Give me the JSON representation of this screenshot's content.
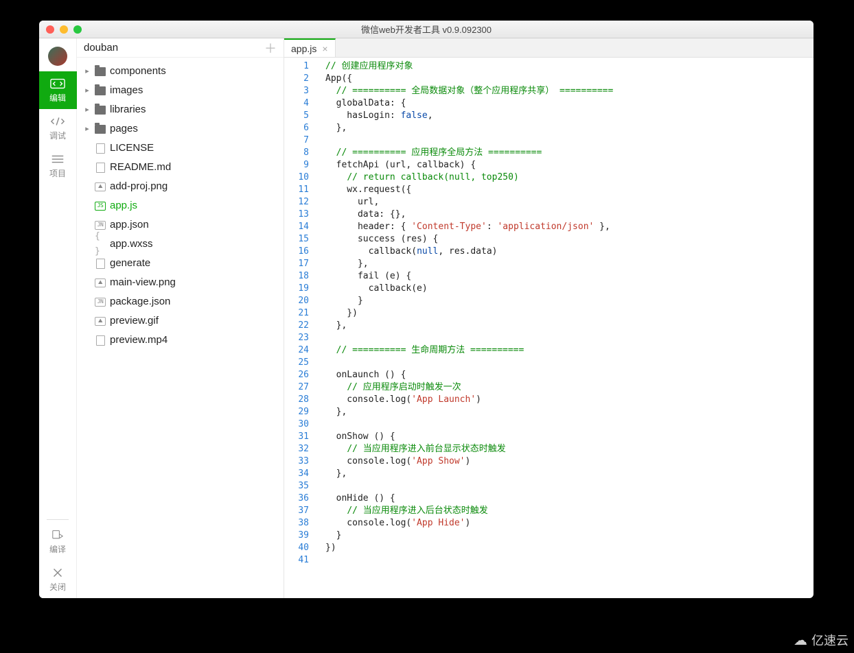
{
  "window": {
    "title": "微信web开发者工具 v0.9.092300"
  },
  "rail": {
    "items": [
      {
        "label": "编辑",
        "icon": "code"
      },
      {
        "label": "调试",
        "icon": "debug"
      },
      {
        "label": "项目",
        "icon": "menu"
      }
    ],
    "bottom": [
      {
        "label": "编译",
        "icon": "compile"
      },
      {
        "label": "关闭",
        "icon": "close"
      }
    ]
  },
  "project": {
    "name": "douban"
  },
  "tree": [
    {
      "type": "folder",
      "name": "components"
    },
    {
      "type": "folder",
      "name": "images"
    },
    {
      "type": "folder",
      "name": "libraries"
    },
    {
      "type": "folder",
      "name": "pages"
    },
    {
      "type": "file",
      "name": "LICENSE",
      "icon": "file"
    },
    {
      "type": "file",
      "name": "README.md",
      "icon": "file"
    },
    {
      "type": "file",
      "name": "add-proj.png",
      "icon": "img"
    },
    {
      "type": "file",
      "name": "app.js",
      "icon": "js",
      "active": true
    },
    {
      "type": "file",
      "name": "app.json",
      "icon": "jn"
    },
    {
      "type": "file",
      "name": "app.wxss",
      "icon": "curly"
    },
    {
      "type": "file",
      "name": "generate",
      "icon": "file"
    },
    {
      "type": "file",
      "name": "main-view.png",
      "icon": "img"
    },
    {
      "type": "file",
      "name": "package.json",
      "icon": "jn"
    },
    {
      "type": "file",
      "name": "preview.gif",
      "icon": "img"
    },
    {
      "type": "file",
      "name": "preview.mp4",
      "icon": "file"
    }
  ],
  "tab": {
    "label": "app.js"
  },
  "code": [
    [
      {
        "t": "// 创建应用程序对象",
        "c": "c-comment"
      }
    ],
    [
      {
        "t": "App({"
      }
    ],
    [
      {
        "t": "  "
      },
      {
        "t": "// ========== 全局数据对象（整个应用程序共享） ==========",
        "c": "c-comment"
      }
    ],
    [
      {
        "t": "  globalData: {"
      }
    ],
    [
      {
        "t": "    hasLogin: "
      },
      {
        "t": "false",
        "c": "c-bool"
      },
      {
        "t": ","
      }
    ],
    [
      {
        "t": "  },"
      }
    ],
    [
      {
        "t": ""
      }
    ],
    [
      {
        "t": "  "
      },
      {
        "t": "// ========== 应用程序全局方法 ==========",
        "c": "c-comment"
      }
    ],
    [
      {
        "t": "  fetchApi (url, callback) {"
      }
    ],
    [
      {
        "t": "    "
      },
      {
        "t": "// return callback(null, top250)",
        "c": "c-comment"
      }
    ],
    [
      {
        "t": "    wx.request({"
      }
    ],
    [
      {
        "t": "      url,"
      }
    ],
    [
      {
        "t": "      data: {},"
      }
    ],
    [
      {
        "t": "      header: { "
      },
      {
        "t": "'Content-Type'",
        "c": "c-str"
      },
      {
        "t": ": "
      },
      {
        "t": "'application/json'",
        "c": "c-str"
      },
      {
        "t": " },"
      }
    ],
    [
      {
        "t": "      success (res) {"
      }
    ],
    [
      {
        "t": "        callback("
      },
      {
        "t": "null",
        "c": "c-null"
      },
      {
        "t": ", res.data)"
      }
    ],
    [
      {
        "t": "      },"
      }
    ],
    [
      {
        "t": "      fail (e) {"
      }
    ],
    [
      {
        "t": "        callback(e)"
      }
    ],
    [
      {
        "t": "      }"
      }
    ],
    [
      {
        "t": "    })"
      }
    ],
    [
      {
        "t": "  },"
      }
    ],
    [
      {
        "t": ""
      }
    ],
    [
      {
        "t": "  "
      },
      {
        "t": "// ========== 生命周期方法 ==========",
        "c": "c-comment"
      }
    ],
    [
      {
        "t": ""
      }
    ],
    [
      {
        "t": "  onLaunch () {"
      }
    ],
    [
      {
        "t": "    "
      },
      {
        "t": "// 应用程序启动时触发一次",
        "c": "c-comment"
      }
    ],
    [
      {
        "t": "    console.log("
      },
      {
        "t": "'App Launch'",
        "c": "c-str"
      },
      {
        "t": ")"
      }
    ],
    [
      {
        "t": "  },"
      }
    ],
    [
      {
        "t": ""
      }
    ],
    [
      {
        "t": "  onShow () {"
      }
    ],
    [
      {
        "t": "    "
      },
      {
        "t": "// 当应用程序进入前台显示状态时触发",
        "c": "c-comment"
      }
    ],
    [
      {
        "t": "    console.log("
      },
      {
        "t": "'App Show'",
        "c": "c-str"
      },
      {
        "t": ")"
      }
    ],
    [
      {
        "t": "  },"
      }
    ],
    [
      {
        "t": ""
      }
    ],
    [
      {
        "t": "  onHide () {"
      }
    ],
    [
      {
        "t": "    "
      },
      {
        "t": "// 当应用程序进入后台状态时触发",
        "c": "c-comment"
      }
    ],
    [
      {
        "t": "    console.log("
      },
      {
        "t": "'App Hide'",
        "c": "c-str"
      },
      {
        "t": ")"
      }
    ],
    [
      {
        "t": "  }"
      }
    ],
    [
      {
        "t": "})"
      }
    ],
    [
      {
        "t": ""
      }
    ]
  ],
  "watermark": "亿速云"
}
